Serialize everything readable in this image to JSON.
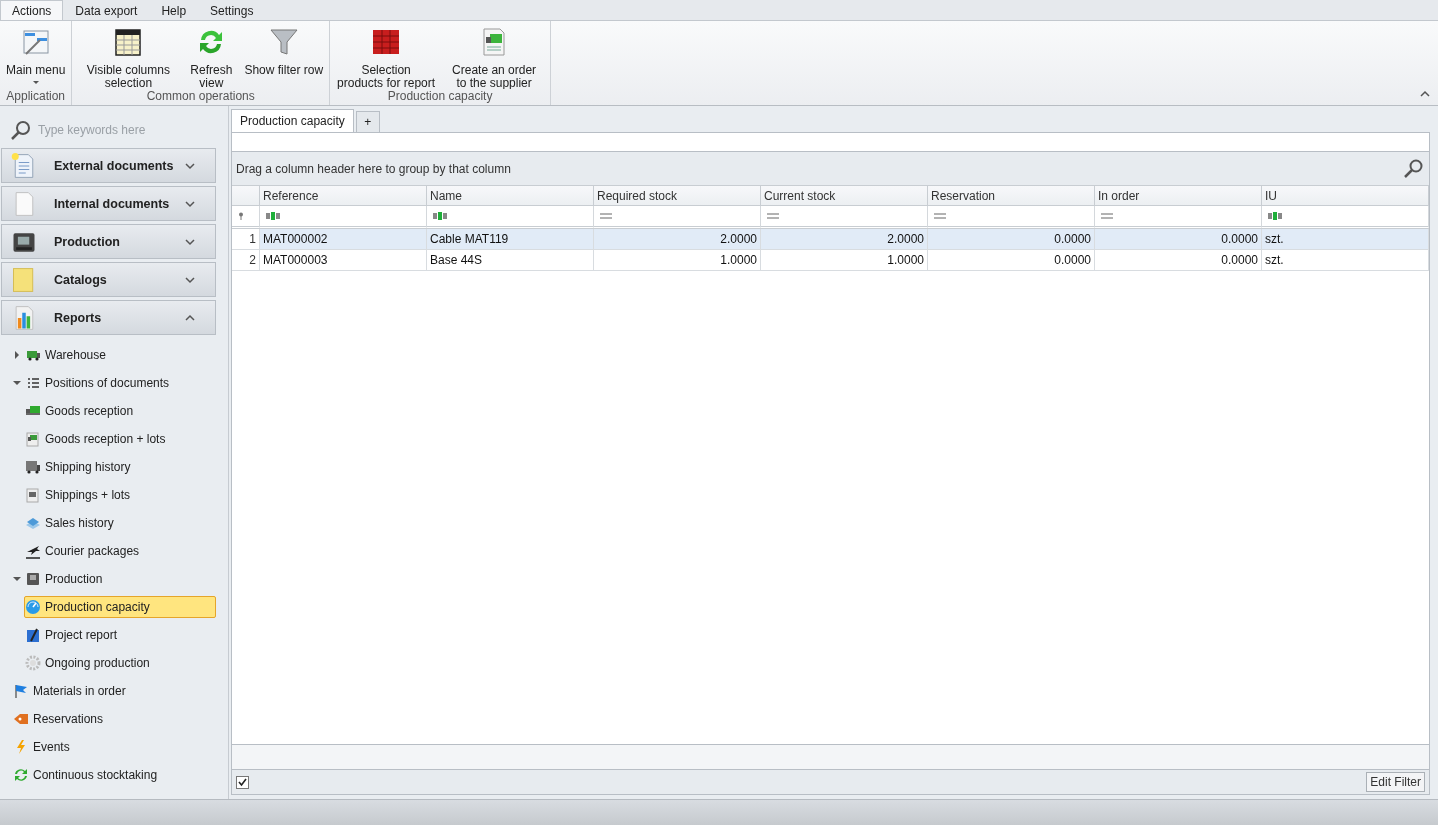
{
  "ribbon": {
    "tabs": [
      {
        "label": "Actions",
        "selected": true
      },
      {
        "label": "Data export",
        "selected": false
      },
      {
        "label": "Help",
        "selected": false
      },
      {
        "label": "Settings",
        "selected": false
      }
    ],
    "groups": [
      {
        "label": "Application",
        "buttons": [
          {
            "label": "Main menu",
            "dropdown": true
          }
        ]
      },
      {
        "label": "Common operations",
        "buttons": [
          {
            "label": "Visible columns selection"
          },
          {
            "label": "Refresh view"
          },
          {
            "label": "Show filter row"
          }
        ]
      },
      {
        "label": "Production capacity",
        "buttons": [
          {
            "label": "Selection products for report"
          },
          {
            "label": "Create an order to the supplier"
          }
        ]
      }
    ]
  },
  "sidebar": {
    "search": {
      "placeholder": "Type keywords here"
    },
    "sections": [
      {
        "label": "External documents",
        "expanded": false
      },
      {
        "label": "Internal documents",
        "expanded": false
      },
      {
        "label": "Production",
        "expanded": false
      },
      {
        "label": "Catalogs",
        "expanded": false
      },
      {
        "label": "Reports",
        "expanded": true
      }
    ],
    "tree": [
      {
        "label": "Warehouse",
        "has_children": true,
        "expanded": false,
        "selected": false
      },
      {
        "label": "Positions of documents",
        "has_children": true,
        "expanded": true,
        "selected": false,
        "children": [
          {
            "label": "Goods reception",
            "has_children": false,
            "selected": false
          },
          {
            "label": "Goods reception + lots",
            "has_children": false,
            "selected": false
          },
          {
            "label": "Shipping history",
            "has_children": false,
            "selected": false
          },
          {
            "label": "Shippings + lots",
            "has_children": false,
            "selected": false
          },
          {
            "label": "Sales history",
            "has_children": false,
            "selected": false
          },
          {
            "label": "Courier packages",
            "has_children": false,
            "selected": false
          }
        ]
      },
      {
        "label": "Production",
        "has_children": true,
        "expanded": true,
        "selected": false,
        "children": [
          {
            "label": "Production capacity",
            "has_children": false,
            "selected": true
          },
          {
            "label": "Project report",
            "has_children": false,
            "selected": false
          },
          {
            "label": "Ongoing production",
            "has_children": false,
            "selected": false
          }
        ]
      },
      {
        "label": "Materials in order",
        "has_children": false,
        "selected": false
      },
      {
        "label": "Reservations",
        "has_children": false,
        "selected": false
      },
      {
        "label": "Events",
        "has_children": false,
        "selected": false
      },
      {
        "label": "Continuous stocktaking",
        "has_children": false,
        "selected": false
      }
    ]
  },
  "document_tabs": [
    {
      "label": "Production capacity",
      "selected": true
    }
  ],
  "add_tab": "+",
  "grid": {
    "group_panel": "Drag a column header here to group by that column",
    "columns": [
      {
        "label": "Reference",
        "kind": "text"
      },
      {
        "label": "Name",
        "kind": "text"
      },
      {
        "label": "Required stock",
        "kind": "number"
      },
      {
        "label": "Current stock",
        "kind": "number"
      },
      {
        "label": "Reservation",
        "kind": "number"
      },
      {
        "label": "In order",
        "kind": "number"
      },
      {
        "label": "IU",
        "kind": "text"
      }
    ],
    "rows": [
      {
        "number": "1",
        "selected": true,
        "cells": [
          "MAT000002",
          "Cable MAT119",
          "2.0000",
          "2.0000",
          "0.0000",
          "0.0000",
          "szt."
        ]
      },
      {
        "number": "2",
        "selected": false,
        "cells": [
          "MAT000003",
          "Base 44S",
          "1.0000",
          "1.0000",
          "0.0000",
          "0.0000",
          "szt."
        ]
      }
    ],
    "footer": {
      "filter_enabled": true,
      "edit_filter": "Edit Filter"
    }
  }
}
